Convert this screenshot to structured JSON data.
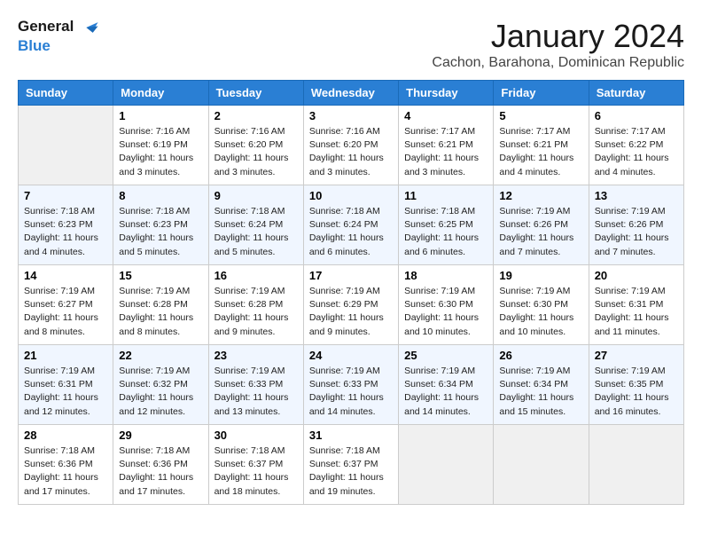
{
  "logo": {
    "line1": "General",
    "line2": "Blue"
  },
  "title": "January 2024",
  "location": "Cachon, Barahona, Dominican Republic",
  "days_of_week": [
    "Sunday",
    "Monday",
    "Tuesday",
    "Wednesday",
    "Thursday",
    "Friday",
    "Saturday"
  ],
  "weeks": [
    [
      {
        "num": "",
        "sunrise": "",
        "sunset": "",
        "daylight": ""
      },
      {
        "num": "1",
        "sunrise": "Sunrise: 7:16 AM",
        "sunset": "Sunset: 6:19 PM",
        "daylight": "Daylight: 11 hours and 3 minutes."
      },
      {
        "num": "2",
        "sunrise": "Sunrise: 7:16 AM",
        "sunset": "Sunset: 6:20 PM",
        "daylight": "Daylight: 11 hours and 3 minutes."
      },
      {
        "num": "3",
        "sunrise": "Sunrise: 7:16 AM",
        "sunset": "Sunset: 6:20 PM",
        "daylight": "Daylight: 11 hours and 3 minutes."
      },
      {
        "num": "4",
        "sunrise": "Sunrise: 7:17 AM",
        "sunset": "Sunset: 6:21 PM",
        "daylight": "Daylight: 11 hours and 3 minutes."
      },
      {
        "num": "5",
        "sunrise": "Sunrise: 7:17 AM",
        "sunset": "Sunset: 6:21 PM",
        "daylight": "Daylight: 11 hours and 4 minutes."
      },
      {
        "num": "6",
        "sunrise": "Sunrise: 7:17 AM",
        "sunset": "Sunset: 6:22 PM",
        "daylight": "Daylight: 11 hours and 4 minutes."
      }
    ],
    [
      {
        "num": "7",
        "sunrise": "Sunrise: 7:18 AM",
        "sunset": "Sunset: 6:23 PM",
        "daylight": "Daylight: 11 hours and 4 minutes."
      },
      {
        "num": "8",
        "sunrise": "Sunrise: 7:18 AM",
        "sunset": "Sunset: 6:23 PM",
        "daylight": "Daylight: 11 hours and 5 minutes."
      },
      {
        "num": "9",
        "sunrise": "Sunrise: 7:18 AM",
        "sunset": "Sunset: 6:24 PM",
        "daylight": "Daylight: 11 hours and 5 minutes."
      },
      {
        "num": "10",
        "sunrise": "Sunrise: 7:18 AM",
        "sunset": "Sunset: 6:24 PM",
        "daylight": "Daylight: 11 hours and 6 minutes."
      },
      {
        "num": "11",
        "sunrise": "Sunrise: 7:18 AM",
        "sunset": "Sunset: 6:25 PM",
        "daylight": "Daylight: 11 hours and 6 minutes."
      },
      {
        "num": "12",
        "sunrise": "Sunrise: 7:19 AM",
        "sunset": "Sunset: 6:26 PM",
        "daylight": "Daylight: 11 hours and 7 minutes."
      },
      {
        "num": "13",
        "sunrise": "Sunrise: 7:19 AM",
        "sunset": "Sunset: 6:26 PM",
        "daylight": "Daylight: 11 hours and 7 minutes."
      }
    ],
    [
      {
        "num": "14",
        "sunrise": "Sunrise: 7:19 AM",
        "sunset": "Sunset: 6:27 PM",
        "daylight": "Daylight: 11 hours and 8 minutes."
      },
      {
        "num": "15",
        "sunrise": "Sunrise: 7:19 AM",
        "sunset": "Sunset: 6:28 PM",
        "daylight": "Daylight: 11 hours and 8 minutes."
      },
      {
        "num": "16",
        "sunrise": "Sunrise: 7:19 AM",
        "sunset": "Sunset: 6:28 PM",
        "daylight": "Daylight: 11 hours and 9 minutes."
      },
      {
        "num": "17",
        "sunrise": "Sunrise: 7:19 AM",
        "sunset": "Sunset: 6:29 PM",
        "daylight": "Daylight: 11 hours and 9 minutes."
      },
      {
        "num": "18",
        "sunrise": "Sunrise: 7:19 AM",
        "sunset": "Sunset: 6:30 PM",
        "daylight": "Daylight: 11 hours and 10 minutes."
      },
      {
        "num": "19",
        "sunrise": "Sunrise: 7:19 AM",
        "sunset": "Sunset: 6:30 PM",
        "daylight": "Daylight: 11 hours and 10 minutes."
      },
      {
        "num": "20",
        "sunrise": "Sunrise: 7:19 AM",
        "sunset": "Sunset: 6:31 PM",
        "daylight": "Daylight: 11 hours and 11 minutes."
      }
    ],
    [
      {
        "num": "21",
        "sunrise": "Sunrise: 7:19 AM",
        "sunset": "Sunset: 6:31 PM",
        "daylight": "Daylight: 11 hours and 12 minutes."
      },
      {
        "num": "22",
        "sunrise": "Sunrise: 7:19 AM",
        "sunset": "Sunset: 6:32 PM",
        "daylight": "Daylight: 11 hours and 12 minutes."
      },
      {
        "num": "23",
        "sunrise": "Sunrise: 7:19 AM",
        "sunset": "Sunset: 6:33 PM",
        "daylight": "Daylight: 11 hours and 13 minutes."
      },
      {
        "num": "24",
        "sunrise": "Sunrise: 7:19 AM",
        "sunset": "Sunset: 6:33 PM",
        "daylight": "Daylight: 11 hours and 14 minutes."
      },
      {
        "num": "25",
        "sunrise": "Sunrise: 7:19 AM",
        "sunset": "Sunset: 6:34 PM",
        "daylight": "Daylight: 11 hours and 14 minutes."
      },
      {
        "num": "26",
        "sunrise": "Sunrise: 7:19 AM",
        "sunset": "Sunset: 6:34 PM",
        "daylight": "Daylight: 11 hours and 15 minutes."
      },
      {
        "num": "27",
        "sunrise": "Sunrise: 7:19 AM",
        "sunset": "Sunset: 6:35 PM",
        "daylight": "Daylight: 11 hours and 16 minutes."
      }
    ],
    [
      {
        "num": "28",
        "sunrise": "Sunrise: 7:18 AM",
        "sunset": "Sunset: 6:36 PM",
        "daylight": "Daylight: 11 hours and 17 minutes."
      },
      {
        "num": "29",
        "sunrise": "Sunrise: 7:18 AM",
        "sunset": "Sunset: 6:36 PM",
        "daylight": "Daylight: 11 hours and 17 minutes."
      },
      {
        "num": "30",
        "sunrise": "Sunrise: 7:18 AM",
        "sunset": "Sunset: 6:37 PM",
        "daylight": "Daylight: 11 hours and 18 minutes."
      },
      {
        "num": "31",
        "sunrise": "Sunrise: 7:18 AM",
        "sunset": "Sunset: 6:37 PM",
        "daylight": "Daylight: 11 hours and 19 minutes."
      },
      {
        "num": "",
        "sunrise": "",
        "sunset": "",
        "daylight": ""
      },
      {
        "num": "",
        "sunrise": "",
        "sunset": "",
        "daylight": ""
      },
      {
        "num": "",
        "sunrise": "",
        "sunset": "",
        "daylight": ""
      }
    ]
  ]
}
